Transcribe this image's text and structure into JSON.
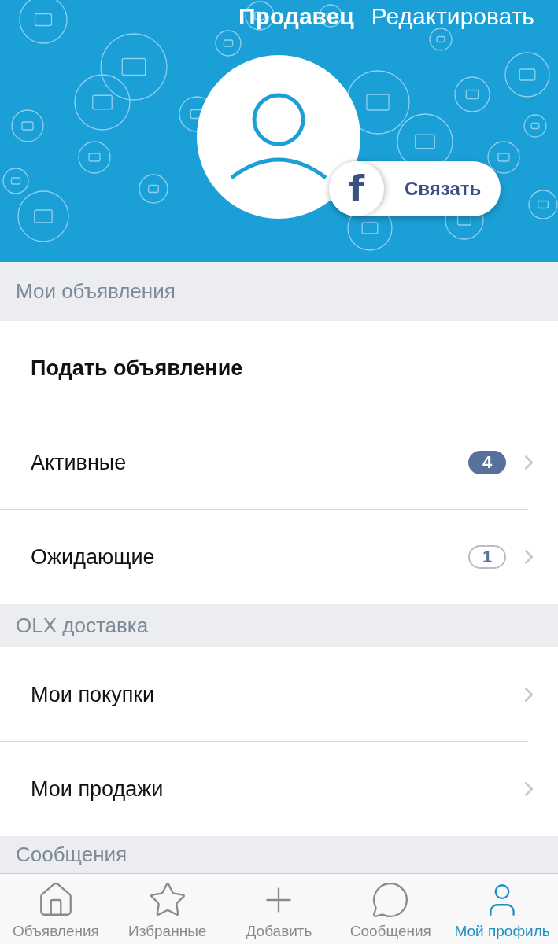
{
  "header": {
    "title": "Продавец",
    "action": "Редактировать",
    "connect_button": {
      "icon_letter": "f",
      "label": "Связать"
    }
  },
  "sections": [
    {
      "title": "Мои объявления",
      "rows": [
        {
          "kind": "action",
          "label": "Подать объявление"
        },
        {
          "kind": "link",
          "label": "Активные",
          "badge": {
            "kind": "filled",
            "count": "4"
          }
        },
        {
          "kind": "link",
          "label": "Ожидающие",
          "badge": {
            "kind": "outline",
            "count": "1"
          }
        }
      ]
    },
    {
      "title": "OLX доставка",
      "rows": [
        {
          "kind": "link",
          "label": "Мои покупки"
        },
        {
          "kind": "link",
          "label": "Мои продажи"
        }
      ]
    },
    {
      "title": "Сообщения"
    }
  ],
  "tab_bar": [
    {
      "kind": "home",
      "label": "Объявления",
      "selected": false
    },
    {
      "kind": "star",
      "label": "Избранные",
      "selected": false
    },
    {
      "kind": "plus",
      "label": "Добавить",
      "selected": false
    },
    {
      "kind": "chat",
      "label": "Сообщения",
      "selected": false
    },
    {
      "kind": "user",
      "label": "Мой профиль",
      "selected": true
    }
  ]
}
